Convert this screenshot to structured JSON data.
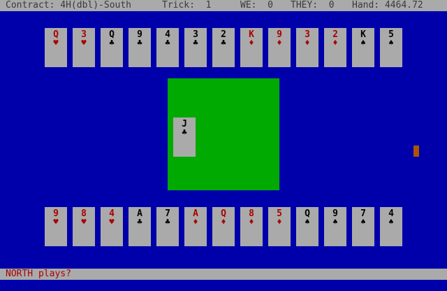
{
  "colors": {
    "table_blue": "#0000aa",
    "felt_green": "#00aa00",
    "card_gray": "#aaaaaa",
    "bar_gray": "#aaaaaa",
    "status_text": "#3a3a3a",
    "red_suit": "#aa0000",
    "black_suit": "#000000",
    "prompt_text": "#aa0000",
    "marker_orange": "#aa5500"
  },
  "status": {
    "contract": "Contract: 4H(dbl)-South",
    "trick": "Trick:  1",
    "we": "WE:  0",
    "they": "THEY:  0",
    "hand": "Hand: 4464.72"
  },
  "north_hand": [
    {
      "rank": "Q",
      "suit": "hearts",
      "symbol": "♥",
      "color": "red"
    },
    {
      "rank": "3",
      "suit": "hearts",
      "symbol": "♥",
      "color": "red"
    },
    {
      "rank": "Q",
      "suit": "clubs",
      "symbol": "♣",
      "color": "black"
    },
    {
      "rank": "9",
      "suit": "clubs",
      "symbol": "♣",
      "color": "black"
    },
    {
      "rank": "4",
      "suit": "clubs",
      "symbol": "♣",
      "color": "black"
    },
    {
      "rank": "3",
      "suit": "clubs",
      "symbol": "♣",
      "color": "black"
    },
    {
      "rank": "2",
      "suit": "clubs",
      "symbol": "♣",
      "color": "black"
    },
    {
      "rank": "K",
      "suit": "diamonds",
      "symbol": "♦",
      "color": "red"
    },
    {
      "rank": "9",
      "suit": "diamonds",
      "symbol": "♦",
      "color": "red"
    },
    {
      "rank": "3",
      "suit": "diamonds",
      "symbol": "♦",
      "color": "red"
    },
    {
      "rank": "2",
      "suit": "diamonds",
      "symbol": "♦",
      "color": "red"
    },
    {
      "rank": "K",
      "suit": "spades",
      "symbol": "♠",
      "color": "black"
    },
    {
      "rank": "5",
      "suit": "spades",
      "symbol": "♠",
      "color": "black"
    }
  ],
  "south_hand": [
    {
      "rank": "9",
      "suit": "hearts",
      "symbol": "♥",
      "color": "red"
    },
    {
      "rank": "8",
      "suit": "hearts",
      "symbol": "♥",
      "color": "red"
    },
    {
      "rank": "4",
      "suit": "hearts",
      "symbol": "♥",
      "color": "red"
    },
    {
      "rank": "A",
      "suit": "clubs",
      "symbol": "♣",
      "color": "black"
    },
    {
      "rank": "7",
      "suit": "clubs",
      "symbol": "♣",
      "color": "black"
    },
    {
      "rank": "A",
      "suit": "diamonds",
      "symbol": "♦",
      "color": "red"
    },
    {
      "rank": "Q",
      "suit": "diamonds",
      "symbol": "♦",
      "color": "red"
    },
    {
      "rank": "8",
      "suit": "diamonds",
      "symbol": "♦",
      "color": "red"
    },
    {
      "rank": "5",
      "suit": "diamonds",
      "symbol": "♦",
      "color": "red"
    },
    {
      "rank": "Q",
      "suit": "spades",
      "symbol": "♠",
      "color": "black"
    },
    {
      "rank": "9",
      "suit": "spades",
      "symbol": "♠",
      "color": "black"
    },
    {
      "rank": "7",
      "suit": "spades",
      "symbol": "♠",
      "color": "black"
    },
    {
      "rank": "4",
      "suit": "spades",
      "symbol": "♠",
      "color": "black"
    }
  ],
  "trick": {
    "west_card": {
      "rank": "J",
      "suit": "clubs",
      "symbol": "♣",
      "color": "black"
    }
  },
  "turn_marker_icon": "turn-indicator-icon",
  "prompt": "NORTH plays?"
}
